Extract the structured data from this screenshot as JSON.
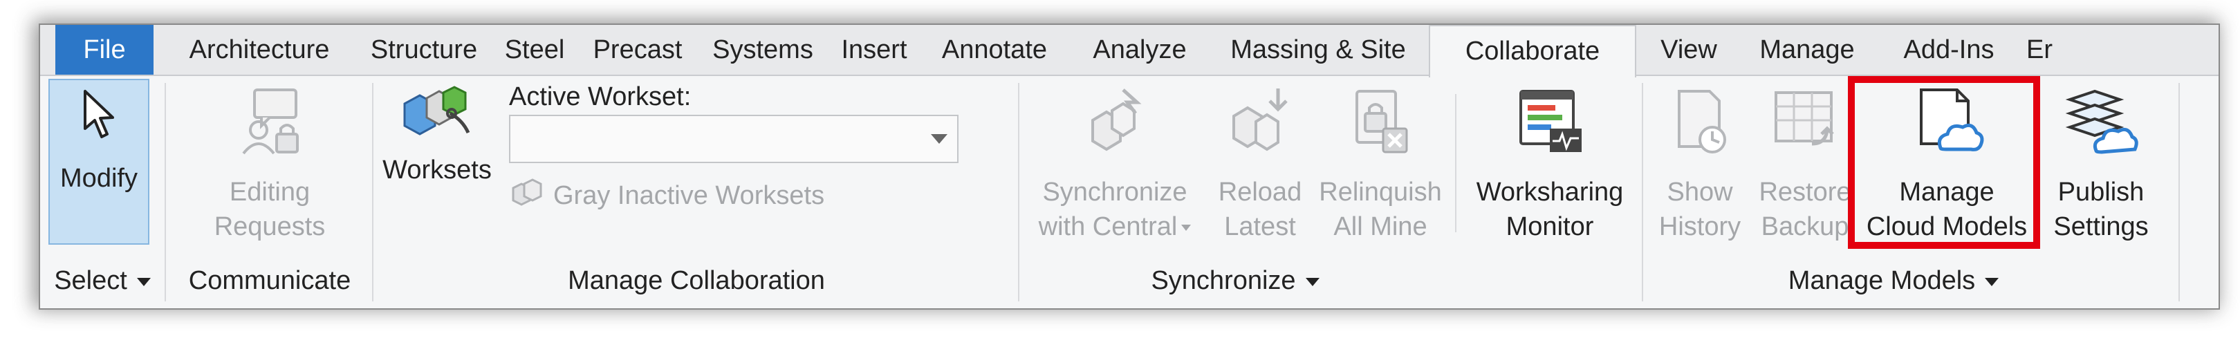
{
  "tabs": [
    "File",
    "Architecture",
    "Structure",
    "Steel",
    "Precast",
    "Systems",
    "Insert",
    "Annotate",
    "Analyze",
    "Massing & Site",
    "Collaborate",
    "View",
    "Manage",
    "Add-Ins",
    "Er"
  ],
  "active_tab": "Collaborate",
  "panels": {
    "select": {
      "label": "Select",
      "modify": "Modify"
    },
    "communicate": {
      "label": "Communicate",
      "editing_requests": [
        "Editing",
        "Requests"
      ]
    },
    "manage_collaboration": {
      "label": "Manage Collaboration",
      "worksets": "Worksets",
      "active_workset_label": "Active Workset:",
      "active_workset_value": "",
      "gray_inactive": "Gray Inactive Worksets"
    },
    "synchronize": {
      "label": "Synchronize",
      "sync_central": [
        "Synchronize",
        "with Central"
      ],
      "reload_latest": [
        "Reload",
        "Latest"
      ],
      "relinquish_all": [
        "Relinquish",
        "All Mine"
      ]
    },
    "worksharing": {
      "monitor": [
        "Worksharing",
        "Monitor"
      ]
    },
    "manage_models": {
      "label": "Manage Models",
      "show_history": [
        "Show",
        "History"
      ],
      "restore_backup": [
        "Restore",
        "Backup"
      ],
      "manage_cloud": [
        "Manage",
        "Cloud Models"
      ],
      "publish_settings": [
        "Publish",
        "Settings"
      ]
    }
  },
  "colors": {
    "file_tab": "#2c77c8",
    "highlight": "#e3000f",
    "modify_bg": "#c7e0f4",
    "cloud": "#2f7fd1"
  }
}
